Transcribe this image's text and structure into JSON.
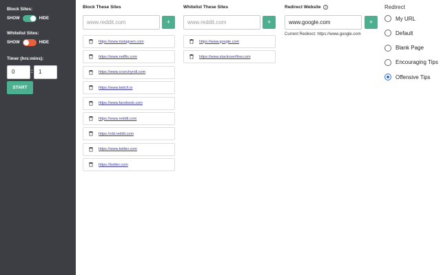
{
  "sidebar": {
    "block_sites_label": "Block Sites:",
    "whitelist_sites_label": "Whitelist Sites:",
    "show_label": "SHOW",
    "hide_label": "HIDE",
    "block_toggle_state": "on",
    "whitelist_toggle_state": "off",
    "timer_label": "Timer (hrs:mins):",
    "timer_hours": "0",
    "timer_minutes": "1",
    "timer_separator": ":",
    "start_label": "START"
  },
  "block": {
    "title": "Block These Sites",
    "placeholder": "www.reddit.com",
    "add_label": "+",
    "sites": [
      "https://www.instagram.com",
      "https://www.netflix.com",
      "https://www.crunchyroll.com",
      "https://www.twitch.tv",
      "https://www.facebook.com",
      "https://www.reddit.com",
      "https://old.reddit.com",
      "https://www.twitter.com",
      "https://twitter.com"
    ]
  },
  "whitelist": {
    "title": "Whitelist These Sites",
    "placeholder": "www.reddit.com",
    "add_label": "+",
    "sites": [
      "https://www.google.com",
      "https://www.stackoverflow.com"
    ]
  },
  "redirect_website": {
    "title": "Redirect Website",
    "info_symbol": "i",
    "value": "www.google.com",
    "add_label": "+",
    "current_label": "Current Redirect: https://www.google.com"
  },
  "redirect_options": {
    "title": "Redirect",
    "options": [
      "My URL",
      "Default",
      "Blank Page",
      "Encouraging Tips",
      "Offensive Tips"
    ],
    "selected": "Offensive Tips"
  },
  "colors": {
    "sidebar_bg": "#3c3e44",
    "accent_green": "#4caf8f",
    "toggle_off": "#e8613c",
    "radio_selected": "#2a6fd6"
  }
}
